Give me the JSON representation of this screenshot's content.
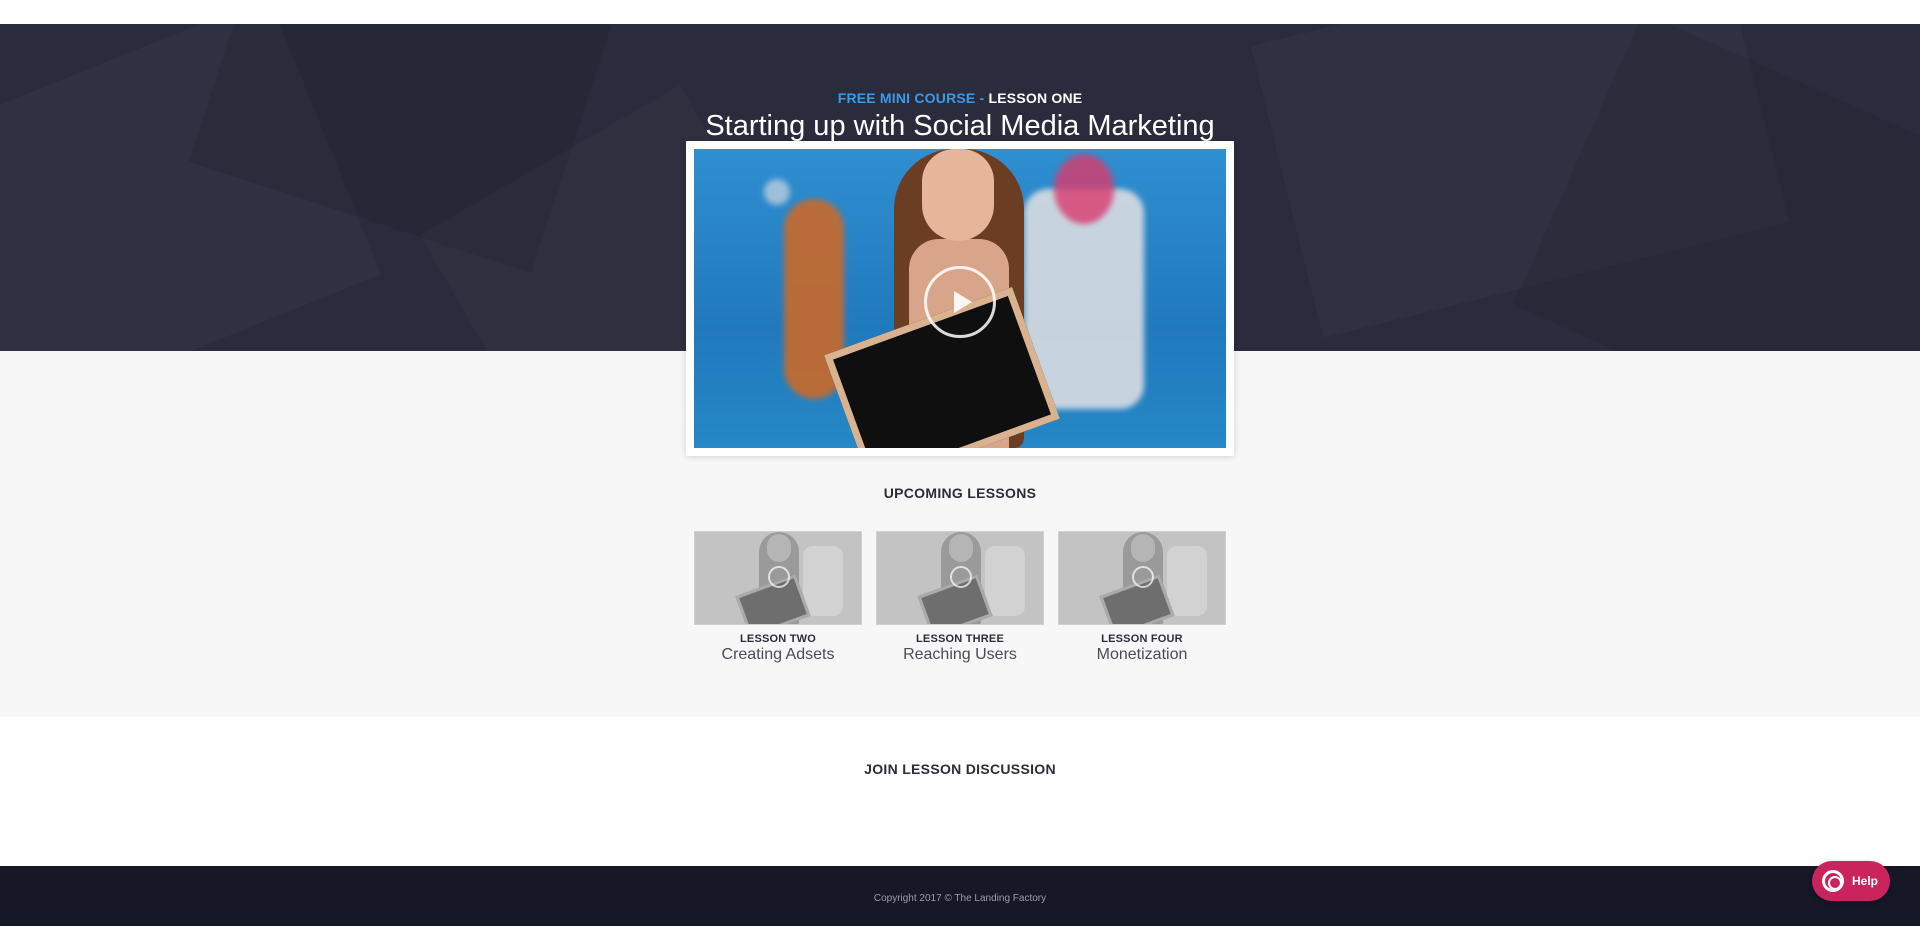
{
  "hero": {
    "eyebrow_prefix": "FREE MINI COURSE -",
    "eyebrow_suffix": "LESSON ONE",
    "title": "Starting up with Social Media Marketing"
  },
  "video": {
    "play_icon": "play-icon"
  },
  "upcoming": {
    "heading": "UPCOMING LESSONS",
    "lessons": [
      {
        "label": "LESSON TWO",
        "title": "Creating Adsets"
      },
      {
        "label": "LESSON THREE",
        "title": "Reaching Users"
      },
      {
        "label": "LESSON FOUR",
        "title": "Monetization"
      }
    ]
  },
  "discussion": {
    "heading": "JOIN LESSON DISCUSSION"
  },
  "footer": {
    "copyright": "Copyright 2017 © The Landing Factory"
  },
  "help": {
    "label": "Help",
    "icon": "lifebuoy-icon"
  },
  "colors": {
    "hero_bg": "#2a2c3d",
    "accent_blue": "#3a9ae8",
    "footer_bg": "#161828",
    "help_bg": "#c9245c"
  }
}
